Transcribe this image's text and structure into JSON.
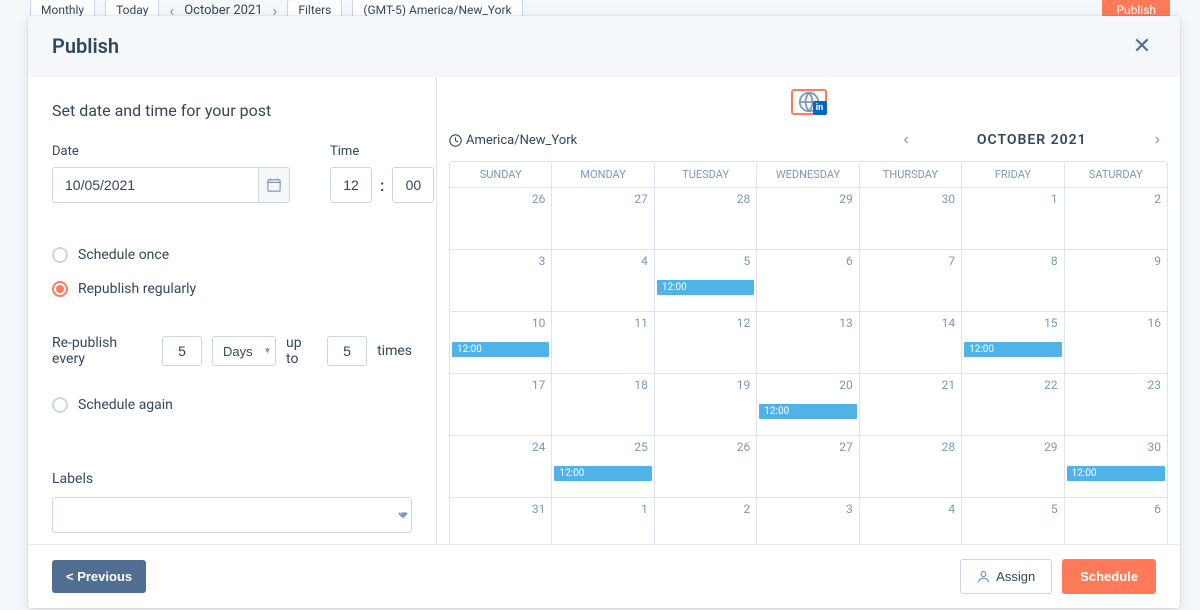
{
  "bg": {
    "monthly": "Monthly",
    "today": "Today",
    "month": "October 2021",
    "filters": "Filters",
    "tz": "(GMT-5) America/New_York",
    "publish": "Publish"
  },
  "modal": {
    "title": "Publish"
  },
  "left": {
    "subtitle": "Set date and time for your post",
    "date_label": "Date",
    "date_value": "10/05/2021",
    "time_label": "Time",
    "hour": "12",
    "minute": "00",
    "schedule_once": "Schedule once",
    "republish_regularly": "Republish regularly",
    "republish_prefix": "Re-publish every",
    "freq_value": "5",
    "unit": "Days",
    "upto_label": "up to",
    "upto_value": "5",
    "times_label": "times",
    "schedule_again": "Schedule again",
    "labels_label": "Labels"
  },
  "calendar": {
    "timezone": "America/New_York",
    "month_label": "OCTOBER 2021",
    "days": [
      "SUNDAY",
      "MONDAY",
      "TUESDAY",
      "WEDNESDAY",
      "THURSDAY",
      "FRIDAY",
      "SATURDAY"
    ],
    "cells": [
      {
        "n": "26"
      },
      {
        "n": "27"
      },
      {
        "n": "28"
      },
      {
        "n": "29"
      },
      {
        "n": "30"
      },
      {
        "n": "1"
      },
      {
        "n": "2"
      },
      {
        "n": "3"
      },
      {
        "n": "4"
      },
      {
        "n": "5",
        "e": "12:00"
      },
      {
        "n": "6"
      },
      {
        "n": "7"
      },
      {
        "n": "8"
      },
      {
        "n": "9"
      },
      {
        "n": "10",
        "e": "12:00"
      },
      {
        "n": "11"
      },
      {
        "n": "12"
      },
      {
        "n": "13"
      },
      {
        "n": "14"
      },
      {
        "n": "15",
        "e": "12:00"
      },
      {
        "n": "16"
      },
      {
        "n": "17"
      },
      {
        "n": "18"
      },
      {
        "n": "19"
      },
      {
        "n": "20",
        "e": "12:00"
      },
      {
        "n": "21"
      },
      {
        "n": "22"
      },
      {
        "n": "23"
      },
      {
        "n": "24"
      },
      {
        "n": "25",
        "e": "12:00"
      },
      {
        "n": "26"
      },
      {
        "n": "27"
      },
      {
        "n": "28"
      },
      {
        "n": "29"
      },
      {
        "n": "30",
        "e": "12:00"
      },
      {
        "n": "31"
      },
      {
        "n": "1"
      },
      {
        "n": "2"
      },
      {
        "n": "3"
      },
      {
        "n": "4"
      },
      {
        "n": "5"
      },
      {
        "n": "6"
      }
    ]
  },
  "footer": {
    "previous": "< Previous",
    "assign": "Assign",
    "schedule": "Schedule"
  }
}
